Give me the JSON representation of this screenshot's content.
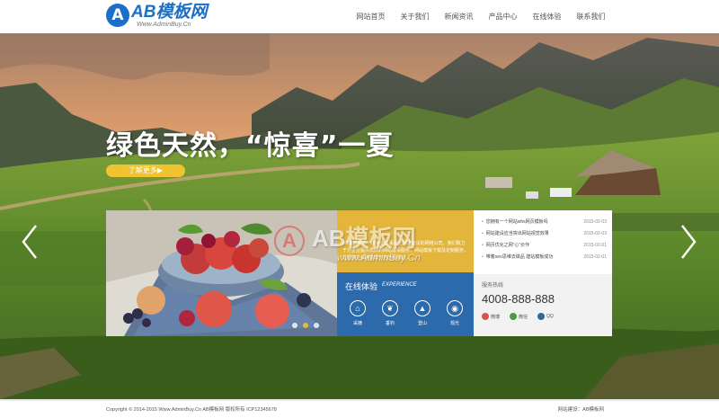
{
  "header": {
    "logo_mark": "A",
    "logo_text": "AB模板网",
    "logo_sub": "Www.AdminBuy.Cn",
    "nav": [
      "网站首页",
      "关于我们",
      "新闻资讯",
      "产品中心",
      "在线体验",
      "联系我们"
    ]
  },
  "hero": {
    "headline": "绿色天然，“惊喜”一夏",
    "cta": "了解更多▶"
  },
  "watermark": {
    "mark": "A",
    "text": "AB模板网",
    "sub": "www.AdminBuy.Cn"
  },
  "panel": {
    "about": "AB模板网是一家专业从事企业网站建设的网络公司，我们致力于为企业提供优质的网站建设服务，网站模板下载及定制服务，让更多企业拥有属于自己的网站……",
    "experience": {
      "title": "在线体验",
      "subtitle": "EXPERIENCE",
      "items": [
        {
          "icon": "home-icon",
          "symbol": "⌂",
          "label": "采摘"
        },
        {
          "icon": "leaf-icon",
          "symbol": "❦",
          "label": "垂钓"
        },
        {
          "icon": "mountain-icon",
          "symbol": "▲",
          "label": "登山"
        },
        {
          "icon": "eye-icon",
          "symbol": "◉",
          "label": "观光"
        }
      ]
    },
    "news": [
      {
        "title": "您拥有一个网站whs网页模板吗",
        "date": "2015-02-03"
      },
      {
        "title": "网站建设应当突出网站视觉效果",
        "date": "2015-02-03"
      },
      {
        "title": "网页优化之网“心”价作",
        "date": "2015-02-01"
      },
      {
        "title": "带着seo思维去做品 建站模板成功",
        "date": "2015-02-01"
      }
    ],
    "contact": {
      "label": "服务热线",
      "number": "4008-888-888",
      "social": [
        {
          "icon": "weibo-icon",
          "label": "微博",
          "color": "#d9534f"
        },
        {
          "icon": "wechat-icon",
          "label": "微信",
          "color": "#4a9e3f"
        },
        {
          "icon": "qq-icon",
          "label": "QQ",
          "color": "#2f6b9a"
        }
      ]
    }
  },
  "footer": {
    "copyright": "Copyright © 2014-2015 Www.AdminBuy.Cn AB模板网 版权所有 ICP12345678",
    "links": "网站建设：AB模板网"
  }
}
